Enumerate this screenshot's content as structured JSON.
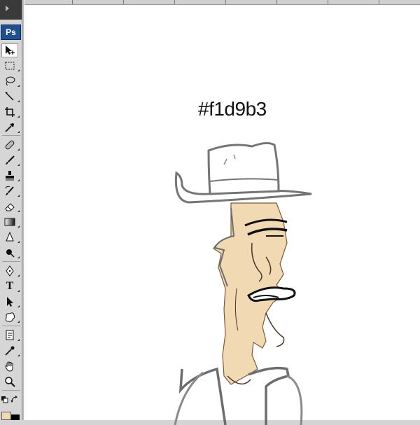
{
  "app": {
    "logo_text": "Ps"
  },
  "toolbar": {
    "tools": [
      {
        "name": "move-tool",
        "icon": "move-icon",
        "active": true
      },
      {
        "name": "marquee-tool",
        "icon": "marquee-icon"
      },
      {
        "name": "lasso-tool",
        "icon": "lasso-icon"
      },
      {
        "name": "quick-select-tool",
        "icon": "magic-wand-icon"
      },
      {
        "name": "crop-tool",
        "icon": "crop-icon"
      },
      {
        "name": "eyedropper-tool",
        "icon": "eyedropper-icon"
      },
      {
        "name": "healing-brush-tool",
        "icon": "bandage-icon"
      },
      {
        "name": "brush-tool",
        "icon": "brush-icon"
      },
      {
        "name": "clone-stamp-tool",
        "icon": "stamp-icon"
      },
      {
        "name": "history-brush-tool",
        "icon": "history-brush-icon"
      },
      {
        "name": "eraser-tool",
        "icon": "eraser-icon"
      },
      {
        "name": "gradient-tool",
        "icon": "gradient-icon"
      },
      {
        "name": "blur-tool",
        "icon": "blur-icon"
      },
      {
        "name": "dodge-tool",
        "icon": "dodge-icon"
      },
      {
        "name": "pen-tool",
        "icon": "pen-icon"
      },
      {
        "name": "type-tool",
        "icon": "type-icon",
        "glyph": "T"
      },
      {
        "name": "path-select-tool",
        "icon": "arrow-icon"
      },
      {
        "name": "shape-tool",
        "icon": "custom-shape-icon"
      },
      {
        "name": "notes-tool",
        "icon": "notes-icon"
      },
      {
        "name": "eyedropper-tool-2",
        "icon": "eyedropper-icon"
      },
      {
        "name": "hand-tool",
        "icon": "hand-icon"
      },
      {
        "name": "zoom-tool",
        "icon": "zoom-icon"
      }
    ]
  },
  "colors": {
    "foreground": "#f1d9b3",
    "background": "#000000"
  },
  "canvas": {
    "hex_label": "#f1d9b3",
    "skin_color": "#f1d9b3"
  }
}
